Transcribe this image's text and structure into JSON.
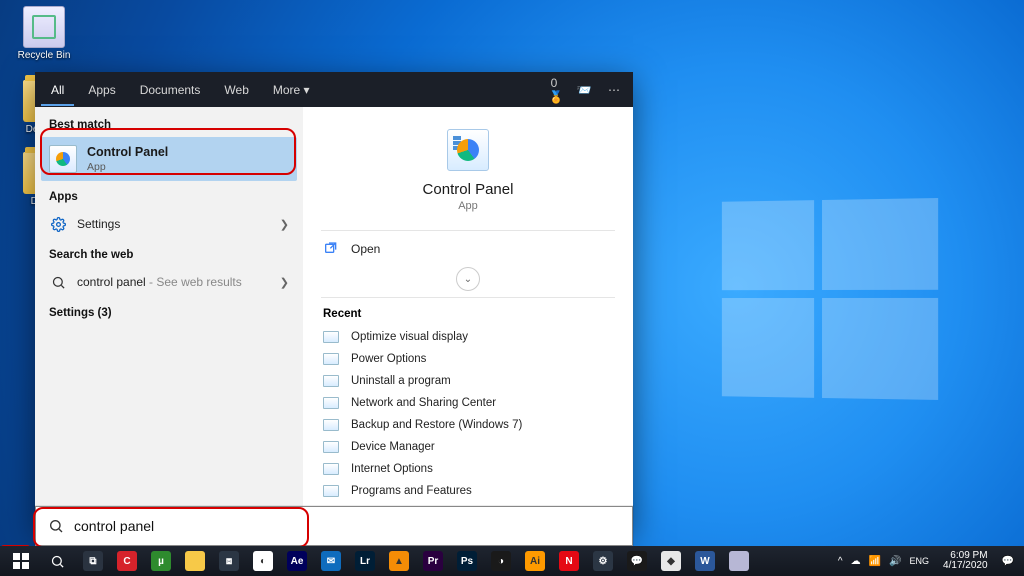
{
  "desktop": {
    "icons": [
      {
        "label": "Recycle Bin"
      },
      {
        "label": "Desktop"
      },
      {
        "label": "Demo"
      }
    ]
  },
  "search": {
    "header": {
      "tabs": [
        "All",
        "Apps",
        "Documents",
        "Web",
        "More"
      ],
      "reward_count": "0"
    },
    "sections": {
      "best_match_label": "Best match",
      "apps_label": "Apps",
      "search_web_label": "Search the web",
      "settings_count_label": "Settings (3)"
    },
    "best_match": {
      "title": "Control Panel",
      "subtitle": "App"
    },
    "apps_items": [
      {
        "label": "Settings"
      }
    ],
    "web_items": [
      {
        "query": "control panel",
        "suffix": " - See web results"
      }
    ],
    "preview": {
      "title": "Control Panel",
      "subtitle": "App",
      "actions": {
        "open": "Open"
      },
      "recent_label": "Recent",
      "recent": [
        "Optimize visual display",
        "Power Options",
        "Uninstall a program",
        "Network and Sharing Center",
        "Backup and Restore (Windows 7)",
        "Device Manager",
        "Internet Options",
        "Programs and Features"
      ]
    },
    "input": {
      "value": "control panel"
    }
  },
  "taskbar": {
    "start": "start",
    "apps": [
      {
        "name": "task-view",
        "bg": "#2a3340",
        "label": "⧉"
      },
      {
        "name": "ccleaner",
        "bg": "#d6232b",
        "label": "C"
      },
      {
        "name": "utorrent",
        "bg": "#2e8b2e",
        "label": "µ"
      },
      {
        "name": "file-explorer",
        "bg": "#f7c948",
        "label": ""
      },
      {
        "name": "microsoft-store",
        "bg": "#2b3644",
        "label": "⧈"
      },
      {
        "name": "chrome",
        "bg": "#ffffff",
        "label": "◐"
      },
      {
        "name": "after-effects",
        "bg": "#00005b",
        "label": "Ae"
      },
      {
        "name": "mail",
        "bg": "#0f6cbd",
        "label": "✉"
      },
      {
        "name": "lightroom",
        "bg": "#001e36",
        "label": "Lr"
      },
      {
        "name": "vlc",
        "bg": "#f48c06",
        "label": "▲"
      },
      {
        "name": "premiere",
        "bg": "#2a003f",
        "label": "Pr"
      },
      {
        "name": "photoshop",
        "bg": "#001e36",
        "label": "Ps"
      },
      {
        "name": "davinci",
        "bg": "#1a1a1a",
        "label": "◑"
      },
      {
        "name": "illustrator",
        "bg": "#ff9a00",
        "label": "Ai"
      },
      {
        "name": "netflix",
        "bg": "#e50914",
        "label": "N"
      },
      {
        "name": "settings",
        "bg": "#2b3644",
        "label": "⚙"
      },
      {
        "name": "messenger",
        "bg": "#1a1a1a",
        "label": "💬"
      },
      {
        "name": "blender",
        "bg": "#e8e8e8",
        "label": "◆"
      },
      {
        "name": "word",
        "bg": "#2b579a",
        "label": "W"
      },
      {
        "name": "onenote",
        "bg": "#b7b7d5",
        "label": ""
      }
    ],
    "systray": {
      "up": "^",
      "time": "6:09 PM",
      "date": "4/17/2020"
    }
  }
}
